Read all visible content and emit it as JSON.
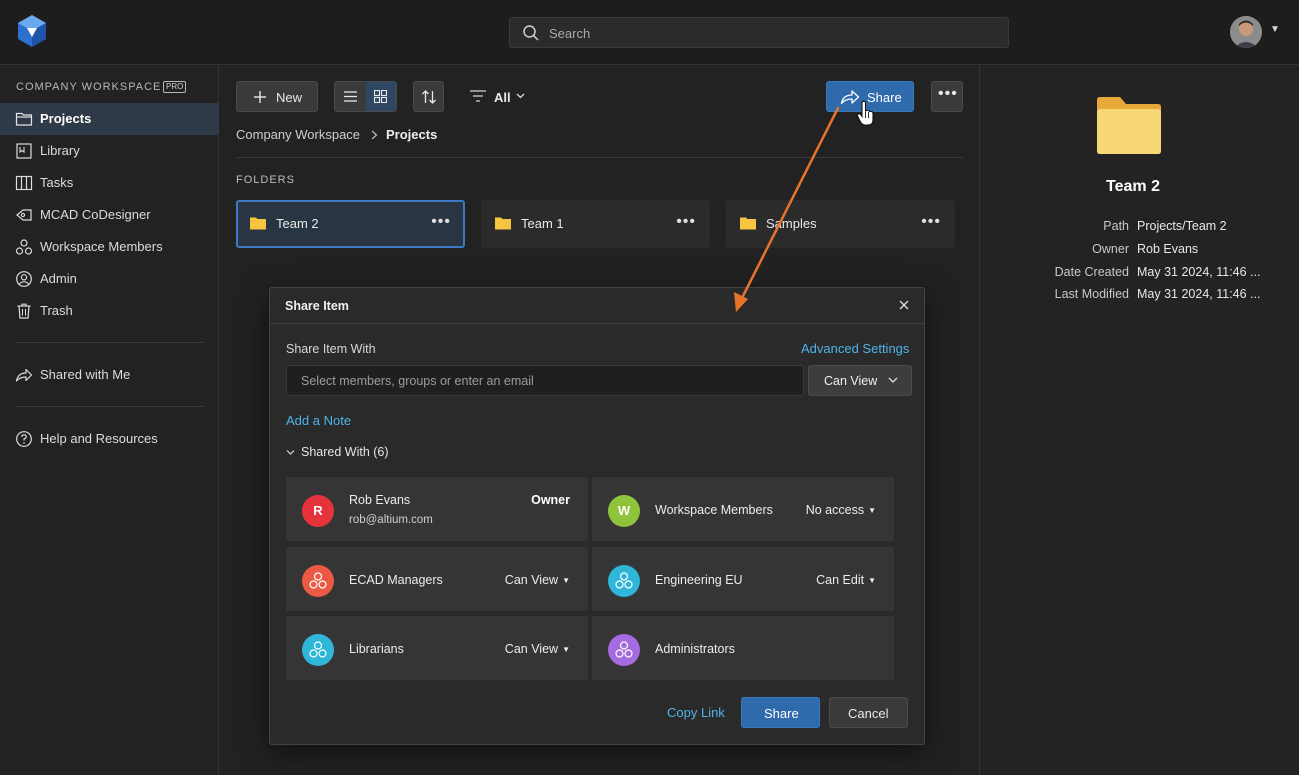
{
  "topbar": {
    "search_placeholder": "Search"
  },
  "sidebar": {
    "workspace_title": "COMPANY WORKSPACE",
    "badge": "PRO",
    "items": [
      {
        "label": "Projects",
        "icon": "folder-outline-icon",
        "active": true
      },
      {
        "label": "Library",
        "icon": "library-icon"
      },
      {
        "label": "Tasks",
        "icon": "tasks-board-icon"
      },
      {
        "label": "MCAD CoDesigner",
        "icon": "mcad-icon"
      },
      {
        "label": "Workspace Members",
        "icon": "members-icon"
      },
      {
        "label": "Admin",
        "icon": "user-circle-icon"
      },
      {
        "label": "Trash",
        "icon": "trash-icon"
      }
    ],
    "shared_with_me": "Shared with Me",
    "help": "Help and Resources"
  },
  "toolbar": {
    "new_label": "New",
    "filter_label": "All",
    "share_label": "Share"
  },
  "breadcrumb": {
    "root": "Company Workspace",
    "current": "Projects"
  },
  "folders": {
    "heading": "FOLDERS",
    "items": [
      {
        "name": "Team 2",
        "selected": true
      },
      {
        "name": "Team 1"
      },
      {
        "name": "Samples"
      }
    ]
  },
  "details": {
    "title": "Team 2",
    "rows": [
      {
        "key": "Path",
        "value": "Projects/Team 2"
      },
      {
        "key": "Owner",
        "value": "Rob Evans"
      },
      {
        "key": "Date Created",
        "value": "May 31 2024, 11:46 ..."
      },
      {
        "key": "Last Modified",
        "value": "May 31 2024, 11:46 ..."
      }
    ]
  },
  "dialog": {
    "title": "Share Item",
    "share_with_label": "Share Item With",
    "advanced_settings": "Advanced Settings",
    "input_placeholder": "Select members, groups or enter an email",
    "permission": "Can View",
    "add_note": "Add a Note",
    "shared_with_header": "Shared With (6)",
    "entries": [
      {
        "name": "Rob Evans",
        "email": "rob@altium.com",
        "permission": "Owner",
        "avatar_letter": "R",
        "color": "#e5333c"
      },
      {
        "name": "Workspace Members",
        "permission": "No access",
        "avatar_letter": "W",
        "color": "#8fc43a"
      },
      {
        "name": "ECAD Managers",
        "permission": "Can View",
        "color": "#ea5a45"
      },
      {
        "name": "Engineering EU",
        "permission": "Can Edit",
        "color": "#2fb6d9"
      },
      {
        "name": "Librarians",
        "permission": "Can View",
        "color": "#2fb6d9"
      },
      {
        "name": "Administrators",
        "permission": "",
        "color": "#a66be0"
      }
    ],
    "copy_link": "Copy Link",
    "share_button": "Share",
    "cancel_button": "Cancel"
  },
  "colors": {
    "accent": "#2f6aad",
    "link": "#4fb3ea",
    "arrow": "#e8742a",
    "folder": "#f5c542"
  }
}
